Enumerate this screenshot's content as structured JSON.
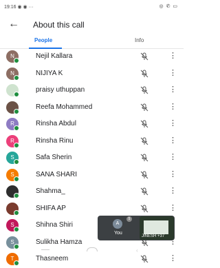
{
  "status_bar": {
    "time": "19:16",
    "left_icons": "◉ ◉ ···",
    "right_icons": "◎ ✆ ▭"
  },
  "header": {
    "title": "About this call"
  },
  "tabs": [
    {
      "label": "People"
    },
    {
      "label": "Info"
    }
  ],
  "participants": [
    {
      "name": "Nejil Kallara",
      "initial": "N",
      "color": "#8d6e63"
    },
    {
      "name": "NIJIYA K",
      "initial": "N",
      "color": "#8d6e63"
    },
    {
      "name": "praisy uthuppan",
      "initial": "",
      "color": "#cfe3cf"
    },
    {
      "name": "Reefa Mohammed",
      "initial": "",
      "color": "#6b5246"
    },
    {
      "name": "Rinsha Abdul",
      "initial": "R",
      "color": "#8e7cc3"
    },
    {
      "name": "Rinsha Rinu",
      "initial": "R",
      "color": "#ec407a"
    },
    {
      "name": "Safa Sherin",
      "initial": "S",
      "color": "#26a69a"
    },
    {
      "name": "SANA SHARI",
      "initial": "S",
      "color": "#f57c00"
    },
    {
      "name": "Shahma_",
      "initial": "",
      "color": "#2e2e2e"
    },
    {
      "name": "SHIFA AP",
      "initial": "",
      "color": "#7a3b2e"
    },
    {
      "name": "Shihna Shiri",
      "initial": "S",
      "color": "#c2185b"
    },
    {
      "name": "Sulikha Hamza",
      "initial": "S",
      "color": "#78909c"
    },
    {
      "name": "Thasneem",
      "initial": "T",
      "color": "#ef6c00"
    }
  ],
  "floating_tile": {
    "self_initial": "A",
    "badge": "5",
    "self_label": "You",
    "thumb_label": "JINESH +37"
  }
}
